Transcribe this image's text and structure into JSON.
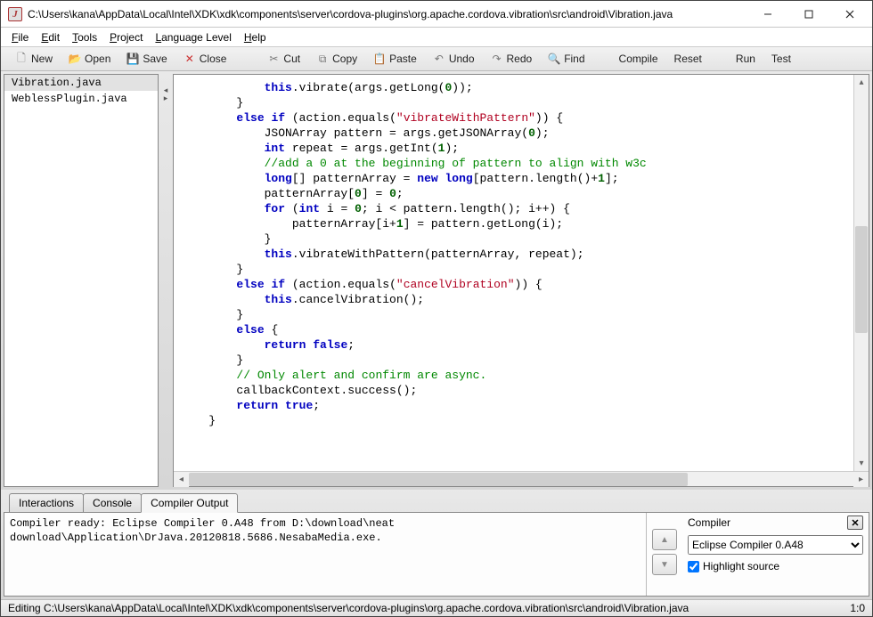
{
  "window": {
    "title": "C:\\Users\\kana\\AppData\\Local\\Intel\\XDK\\xdk\\components\\server\\cordova-plugins\\org.apache.cordova.vibration\\src\\android\\Vibration.java"
  },
  "menu": {
    "file": "File",
    "edit": "Edit",
    "tools": "Tools",
    "project": "Project",
    "language_level": "Language Level",
    "help": "Help"
  },
  "toolbar": {
    "new": "New",
    "open": "Open",
    "save": "Save",
    "close": "Close",
    "cut": "Cut",
    "copy": "Copy",
    "paste": "Paste",
    "undo": "Undo",
    "redo": "Redo",
    "find": "Find",
    "compile": "Compile",
    "reset": "Reset",
    "run": "Run",
    "test": "Test"
  },
  "files": {
    "items": [
      "Vibration.java",
      "WeblessPlugin.java"
    ]
  },
  "bottom_tabs": {
    "interactions": "Interactions",
    "console": "Console",
    "compiler_output": "Compiler Output"
  },
  "compiler": {
    "text": "Compiler ready: Eclipse Compiler 0.A48 from D:\\download\\neat download\\Application\\DrJava.20120818.5686.NesabaMedia.exe.",
    "label": "Compiler",
    "selected": "Eclipse Compiler 0.A48",
    "highlight": "Highlight source"
  },
  "status": {
    "left": "Editing C:\\Users\\kana\\AppData\\Local\\Intel\\XDK\\xdk\\components\\server\\cordova-plugins\\org.apache.cordova.vibration\\src\\android\\Vibration.java",
    "right": "1:0"
  },
  "code": {
    "raw": "            this.vibrate(args.getLong(0));\n        }\n        else if (action.equals(\"vibrateWithPattern\")) {\n            JSONArray pattern = args.getJSONArray(0);\n            int repeat = args.getInt(1);\n            //add a 0 at the beginning of pattern to align with w3c\n            long[] patternArray = new long[pattern.length()+1];\n            patternArray[0] = 0;\n            for (int i = 0; i < pattern.length(); i++) {\n                patternArray[i+1] = pattern.getLong(i);\n            }\n            this.vibrateWithPattern(patternArray, repeat);\n        }\n        else if (action.equals(\"cancelVibration\")) {\n            this.cancelVibration();\n        }\n        else {\n            return false;\n        }\n\n        // Only alert and confirm are async.\n        callbackContext.success();\n\n        return true;\n    }"
  }
}
